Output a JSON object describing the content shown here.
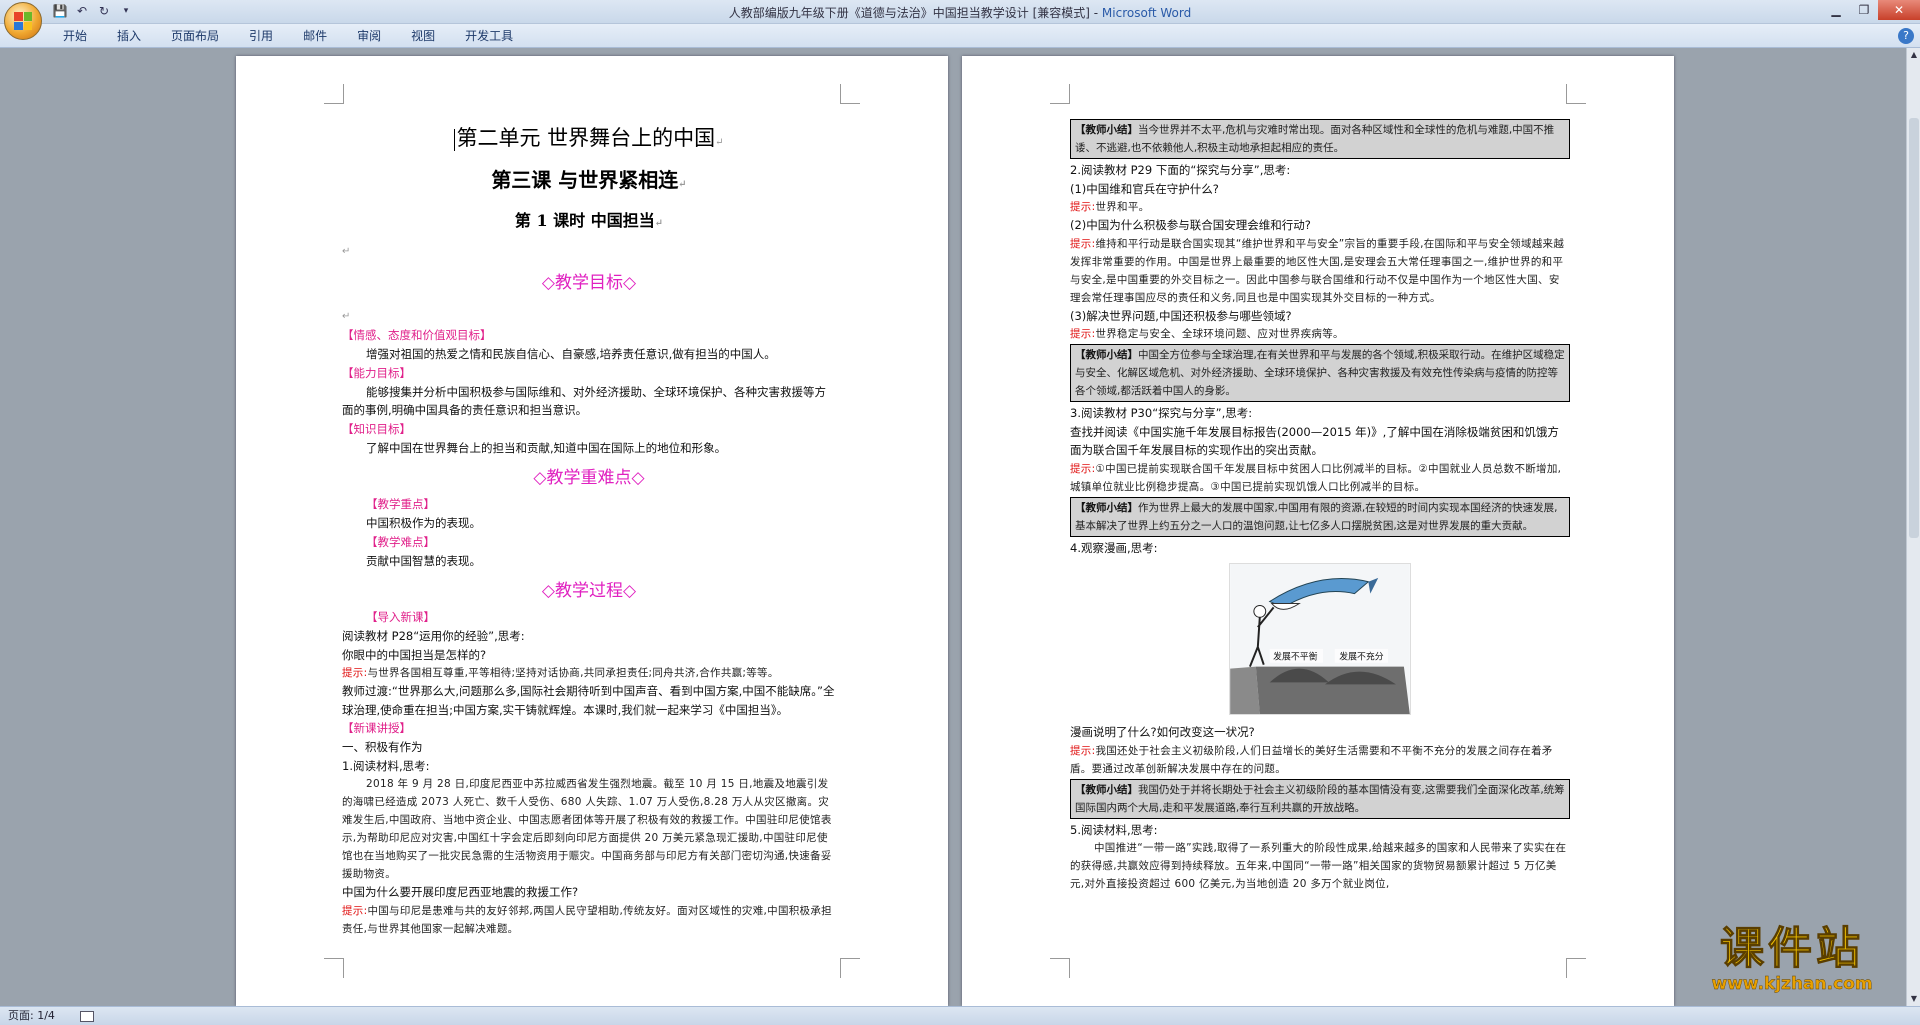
{
  "window": {
    "title_doc": "人教部编版九年级下册《道德与法治》中国担当教学设计 [兼容模式] - ",
    "title_app": "Microsoft Word"
  },
  "ribbon": {
    "tabs": [
      "开始",
      "插入",
      "页面布局",
      "引用",
      "邮件",
      "审阅",
      "视图",
      "开发工具"
    ]
  },
  "status": {
    "page": "页面: 1/4"
  },
  "page1": {
    "h1": "第二单元   世界舞台上的中国",
    "h2": "第三课   与世界紧相连",
    "h3": "第 1 课时   中国担当",
    "sec1": "◇教学目标◇",
    "lbl_emotion": "【情感、态度和价值观目标】",
    "emotion": "增强对祖国的热爱之情和民族自信心、自豪感,培养责任意识,做有担当的中国人。",
    "lbl_ability": "【能力目标】",
    "ability": "能够搜集并分析中国积极参与国际维和、对外经济援助、全球环境保护、各种灾害救援等方面的事例,明确中国具备的责任意识和担当意识。",
    "lbl_knowledge": "【知识目标】",
    "knowledge": "了解中国在世界舞台上的担当和贡献,知道中国在国际上的地位和形象。",
    "sec2": "◇教学重难点◇",
    "lbl_key": "【教学重点】",
    "key": "中国积极作为的表现。",
    "lbl_diff": "【教学难点】",
    "diff": "贡献中国智慧的表现。",
    "sec3": "◇教学过程◇",
    "lbl_intro": "【导入新课】",
    "intro1": "阅读教材 P28“运用你的经验”,思考:",
    "intro2": "你眼中的中国担当是怎样的?",
    "tip_label": "提示:",
    "intro_tip": "与世界各国相互尊重,平等相待;坚持对话协商,共同承担责任;同舟共济,合作共赢;等等。",
    "transition": "教师过渡:“世界那么大,问题那么多,国际社会期待听到中国声音、看到中国方案,中国不能缺席。”全球治理,使命重在担当;中国方案,实干铸就辉煌。本课时,我们就一起来学习《中国担当》。",
    "lbl_new": "【新课讲授】",
    "part1": "一、积极有作为",
    "read1": "1.阅读材料,思考:",
    "material": "2018 年 9 月 28 日,印度尼西亚中苏拉威西省发生强烈地震。截至 10 月 15 日,地震及地震引发的海啸已经造成 2073 人死亡、数千人受伤、680 人失踪、1.07 万人受伤,8.28 万人从灾区撤离。灾难发生后,中国政府、当地中资企业、中国志愿者团体等开展了积极有效的救援工作。中国驻印尼使馆表示,为帮助印尼应对灾害,中国红十字会定后即刻向印尼方面提供 20 万美元紧急现汇援助,中国驻印尼使馆也在当地购买了一批灾民急需的生活物资用于赈灾。中国商务部与印尼方有关部门密切沟通,快速备妥援助物资。",
    "q1": "中国为什么要开展印度尼西亚地震的救援工作?",
    "q1_tip": "中国与印尼是患难与共的友好邻邦,两国人民守望相助,传统友好。面对区域性的灾难,中国积极承担责任,与世界其他国家一起解决难题。"
  },
  "page2": {
    "box1_label": "【教师小结】",
    "box1": "当今世界并不太平,危机与灾难时常出现。面对各种区域性和全球性的危机与难题,中国不推诿、不逃避,也不依赖他人,积极主动地承担起相应的责任。",
    "read2": "2.阅读教材 P29 下面的“探究与分享”,思考:",
    "q2a": "(1)中国维和官兵在守护什么?",
    "tip_label": "提示:",
    "q2a_tip": "世界和平。",
    "q2b": "(2)中国为什么积极参与联合国安理会维和行动?",
    "q2b_tip": "维持和平行动是联合国实现其“维护世界和平与安全”宗旨的重要手段,在国际和平与安全领域越来越发挥非常重要的作用。中国是世界上最重要的地区性大国,是安理会五大常任理事国之一,维护世界的和平与安全,是中国重要的外交目标之一。因此中国参与联合国维和行动不仅是中国作为一个地区性大国、安理会常任理事国应尽的责任和义务,同且也是中国实现其外交目标的一种方式。",
    "q2c": "(3)解决世界问题,中国还积极参与哪些领域?",
    "q2c_tip": "世界稳定与安全、全球环境问题、应对世界疾病等。",
    "box2_label": "【教师小结】",
    "box2": "中国全方位参与全球治理,在有关世界和平与发展的各个领域,积极采取行动。在维护区域稳定与安全、化解区域危机、对外经济援助、全球环境保护、各种灾害救援及有效充性传染病与疫情的防控等各个领域,都活跃着中国人的身影。",
    "read3": "3.阅读教材 P30“探究与分享”,思考:",
    "read3b": "查找并阅读《中国实施千年发展目标报告(2000—2015 年)》,了解中国在消除极端贫困和饥饿方面为联合国千年发展目标的实现作出的突出贡献。",
    "read3_tip": "①中国已提前实现联合国千年发展目标中贫困人口比例减半的目标。②中国就业人员总数不断增加,城镇单位就业比例稳步提高。③中国已提前实现饥饿人口比例减半的目标。",
    "box3_label": "【教师小结】",
    "box3": "作为世界上最大的发展中国家,中国用有限的资源,在较短的时间内实现本国经济的快速发展,基本解决了世界上约五分之一人口的温饱问题,让七亿多人口摆脱贫困,这是对世界发展的重大贡献。",
    "read4": "4.观察漫画,思考:",
    "cartoon_left": "发展不平衡",
    "cartoon_right": "发展不充分",
    "q4": "漫画说明了什么?如何改变这一状况?",
    "q4_tip": "我国还处于社会主义初级阶段,人们日益增长的美好生活需要和不平衡不充分的发展之间存在着矛盾。要通过改革创新解决发展中存在的问题。",
    "box4_label": "【教师小结】",
    "box4": "我国仍处于并将长期处于社会主义初级阶段的基本国情没有变,这需要我们全面深化改革,统筹国际国内两个大局,走和平发展道路,奉行互利共赢的开放战略。",
    "read5": "5.阅读材料,思考:",
    "material5": "中国推进“一带一路”实践,取得了一系列重大的阶段性成果,给越来越多的国家和人民带来了实实在在的获得感,共赢效应得到持续释放。五年来,中国同“一带一路”相关国家的货物贸易额累计超过 5 万亿美元,对外直接投资超过 600 亿美元,为当地创造 20 多万个就业岗位,"
  },
  "watermark": {
    "text": "课件站",
    "url": "www.kjzhan.com"
  },
  "return_mark": "↵"
}
